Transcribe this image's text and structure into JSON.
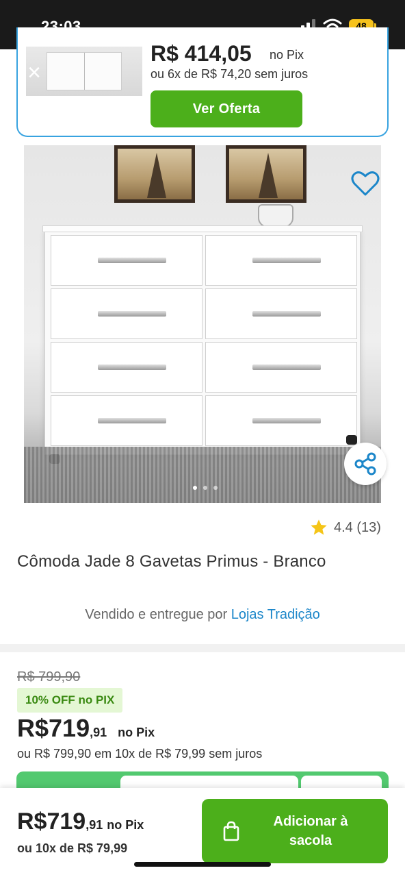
{
  "status_bar": {
    "time": "23:03",
    "battery": "48"
  },
  "offer_card": {
    "price": "R$ 414,05",
    "price_suffix": "no Pix",
    "installments": "ou 6x de R$ 74,20 sem juros",
    "cta": "Ver Oferta"
  },
  "product": {
    "rating": "4.4 (13)",
    "title": "Cômoda Jade 8 Gavetas Primus - Branco",
    "seller_prefix": "Vendido e entregue por",
    "seller_name": "Lojas Tradição",
    "image_dots": 3
  },
  "pricing": {
    "old_price": "R$ 799,90",
    "discount": "10% OFF no PIX",
    "price_main": "R$719",
    "price_cents": ",91",
    "price_suffix": "no Pix",
    "installments": "ou R$ 799,90 em 10x de R$ 79,99 sem juros"
  },
  "bottom_bar": {
    "price_main": "R$719",
    "price_cents": ",91",
    "price_suffix": "no Pix",
    "installments": "ou 10x de R$ 79,99",
    "cta_line1": "Adicionar à",
    "cta_line2": "sacola"
  },
  "colors": {
    "accent_green": "#4caf1b",
    "link_blue": "#1b86c9",
    "discount_bg": "#e4f7d4",
    "card_border": "#38a3e0"
  }
}
